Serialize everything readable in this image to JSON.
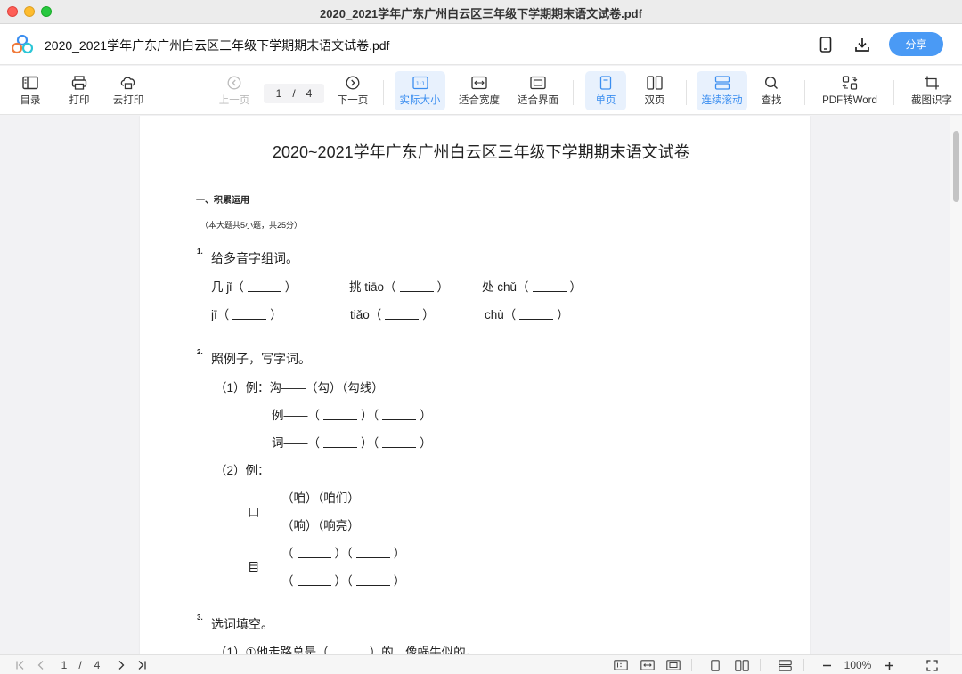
{
  "window": {
    "title": "2020_2021学年广东广州白云区三年级下学期期末语文试卷.pdf"
  },
  "header": {
    "doc_title": "2020_2021学年广东广州白云区三年级下学期期末语文试卷.pdf",
    "share_label": "分享"
  },
  "toolbar": {
    "toc": "目录",
    "print": "打印",
    "cloud_print": "云打印",
    "prev": "上一页",
    "page_current": "1",
    "page_sep": "/",
    "page_total": "4",
    "next": "下一页",
    "actual_size": "实际大小",
    "fit_width": "适合宽度",
    "fit_page": "适合界面",
    "single": "单页",
    "double": "双页",
    "continuous": "连续滚动",
    "find": "查找",
    "pdf_to_word": "PDF转Word",
    "ocr": "截图识字",
    "actual_size_glyph": "1:1"
  },
  "document": {
    "title": "2020~2021学年广东广州白云区三年级下学期期末语文试卷",
    "section1": "一、积累运用",
    "section1_note": "（本大题共5小题，共25分）",
    "q1_num": "1.",
    "q1_text": "给多音字组词。",
    "q1_r1a": "几 jǐ（",
    "q1_r1b": "）",
    "q1_r1c": "挑 tiāo（",
    "q1_r1d": "）",
    "q1_r1e": "处 chǔ（",
    "q1_r1f": "）",
    "q1_r2a": "jī（",
    "q1_r2b": "）",
    "q1_r2c": "tiǎo（",
    "q1_r2d": "）",
    "q1_r2e": "chù（",
    "q1_r2f": "）",
    "q2_num": "2.",
    "q2_text": "照例子，写字词。",
    "q2_1": "（1）例：沟——（勾）（勾线）",
    "q2_1a": "例——（",
    "q2_1b": "）（",
    "q2_1c": "）",
    "q2_1d": "词——（",
    "q2_1e": "）（",
    "q2_1f": "）",
    "q2_2": "（2）例：",
    "q2_kou": "口",
    "q2_kou1": "（咱）（咱们）",
    "q2_kou2": "（响）（响亮）",
    "q2_mu": "目",
    "q2_mu_open": "（",
    "q2_mu_mid": "）（",
    "q2_mu_close": "）",
    "q3_num": "3.",
    "q3_text": "选词填空。",
    "q3_1a": "（1）①他走路总是（",
    "q3_1b": "）的，像蜗牛似的。"
  },
  "status": {
    "page_current": "1",
    "page_sep": "/",
    "page_total": "4",
    "zoom": "100%"
  },
  "colors": {
    "accent": "#4a9af5",
    "active_bg": "#e8f1fd",
    "page_bg": "#f2f2f4"
  }
}
